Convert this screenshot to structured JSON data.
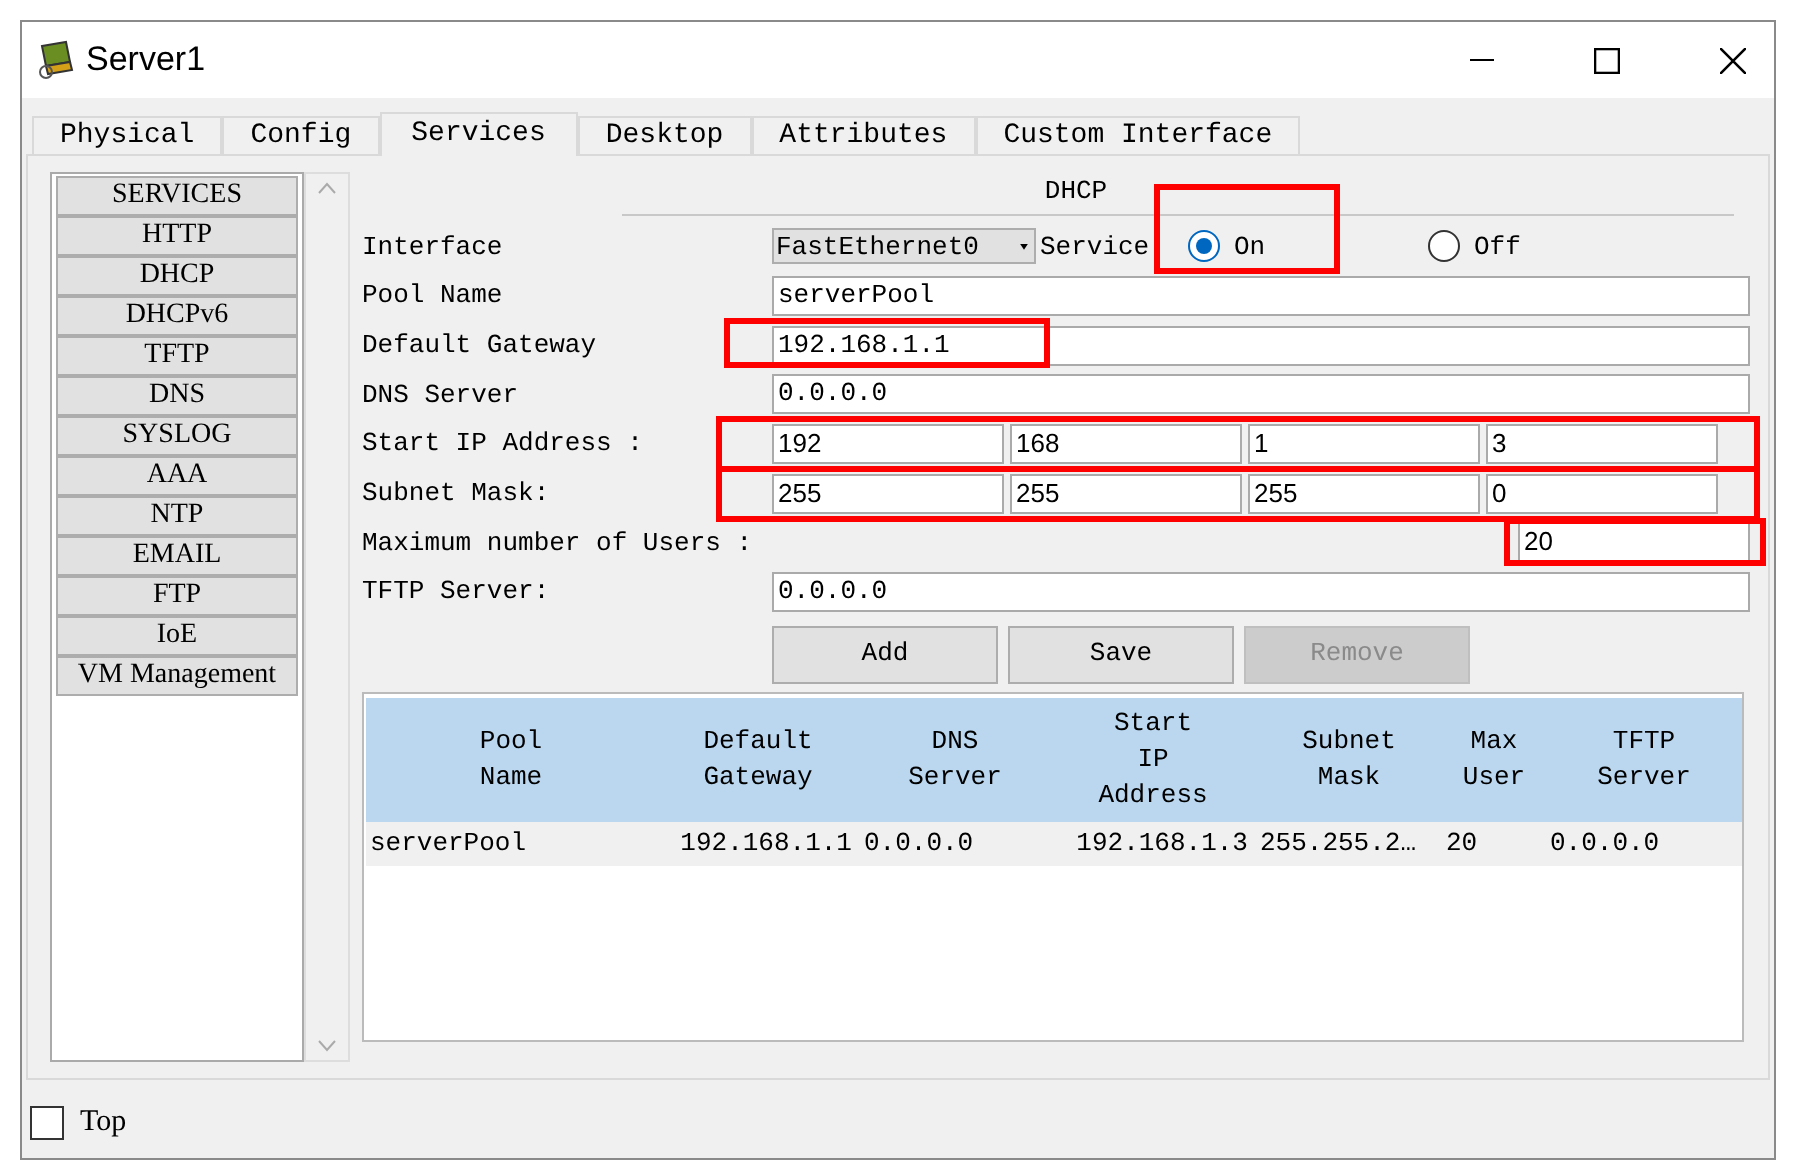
{
  "window": {
    "title": "Server1"
  },
  "tabs": [
    {
      "label": "Physical",
      "selected": false
    },
    {
      "label": "Config",
      "selected": false
    },
    {
      "label": "Services",
      "selected": true
    },
    {
      "label": "Desktop",
      "selected": false
    },
    {
      "label": "Attributes",
      "selected": false
    },
    {
      "label": "Custom Interface",
      "selected": false
    }
  ],
  "sidebar": {
    "items": [
      "SERVICES",
      "HTTP",
      "DHCP",
      "DHCPv6",
      "TFTP",
      "DNS",
      "SYSLOG",
      "AAA",
      "NTP",
      "EMAIL",
      "FTP",
      "IoE",
      "VM Management"
    ]
  },
  "dhcp": {
    "title": "DHCP",
    "interface": {
      "label": "Interface",
      "value": "FastEthernet0"
    },
    "service": {
      "label": "Service",
      "highlighted": true,
      "options": [
        {
          "label": "On",
          "selected": true
        },
        {
          "label": "Off",
          "selected": false
        }
      ]
    },
    "fields": [
      {
        "kind": "text",
        "label": "Pool Name",
        "value": "serverPool",
        "highlighted": false
      },
      {
        "kind": "text",
        "label": "Default Gateway",
        "value": "192.168.1.1",
        "highlighted": true
      },
      {
        "kind": "text",
        "label": "DNS Server",
        "value": "0.0.0.0",
        "highlighted": false
      },
      {
        "kind": "octets",
        "label": "Start IP Address :",
        "values": [
          "192",
          "168",
          "1",
          "3"
        ],
        "highlighted": true
      },
      {
        "kind": "octets",
        "label": "Subnet Mask:",
        "values": [
          "255",
          "255",
          "255",
          "0"
        ],
        "highlighted": true
      },
      {
        "kind": "short",
        "label": "Maximum number of Users :",
        "value": "20",
        "highlighted": true
      },
      {
        "kind": "text",
        "label": "TFTP Server:",
        "value": "0.0.0.0",
        "highlighted": false
      }
    ],
    "buttons": [
      {
        "label": "Add",
        "disabled": false
      },
      {
        "label": "Save",
        "disabled": false
      },
      {
        "label": "Remove",
        "disabled": true
      }
    ]
  },
  "table": {
    "columns": [
      "Pool\nName",
      "Default\nGateway",
      "DNS\nServer",
      "Start\nIP\nAddress",
      "Subnet\nMask",
      "Max\nUser",
      "TFTP\nServer"
    ],
    "rows": [
      [
        "serverPool",
        "192.168.1.1",
        "0.0.0.0",
        "192.168.1.3",
        "255.255.2…",
        "20",
        "0.0.0.0"
      ]
    ]
  },
  "bottom": {
    "label": "Top",
    "checked": false
  }
}
